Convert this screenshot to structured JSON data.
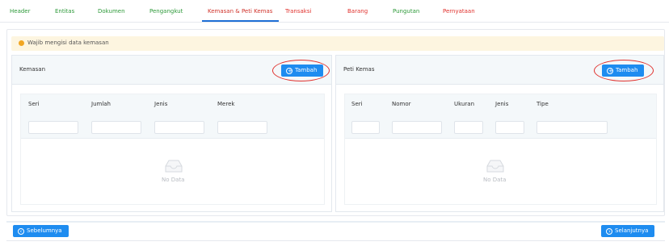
{
  "tabs": [
    {
      "label": "Header"
    },
    {
      "label": "Entitas"
    },
    {
      "label": "Dokumen"
    },
    {
      "label": "Pengangkut"
    },
    {
      "label": "Kemasan & Peti Kemas"
    },
    {
      "label": "Transaksi"
    },
    {
      "label": "Barang"
    },
    {
      "label": "Pungutan"
    },
    {
      "label": "Pernyataan"
    }
  ],
  "notice": {
    "text": "Wajib mengisi data kemasan"
  },
  "kemasan": {
    "title": "Kemasan",
    "add_label": "Tambah",
    "columns": [
      "Seri",
      "Jumlah",
      "Jenis",
      "Merek"
    ],
    "empty_text": "No Data"
  },
  "peti_kemas": {
    "title": "Peti Kemas",
    "add_label": "Tambah",
    "columns": [
      "Seri",
      "Nomor",
      "Ukuran",
      "Jenis",
      "Tipe"
    ],
    "empty_text": "No Data"
  },
  "footer": {
    "prev_label": "Sebelumnya",
    "next_label": "Selanjutnya"
  },
  "colors": {
    "primary": "#1e8cf0",
    "tab_green": "#2e9a3a",
    "tab_red": "#e0312d",
    "active_underline": "#1f6fd6",
    "notice_bg": "#fdf5e0",
    "highlight": "#e0312d"
  },
  "icons": {
    "add": "plus-circle-icon",
    "prev": "chevron-left-circle-icon",
    "next": "chevron-right-circle-icon",
    "empty": "empty-inbox-icon",
    "notice": "warning-dot-icon"
  }
}
